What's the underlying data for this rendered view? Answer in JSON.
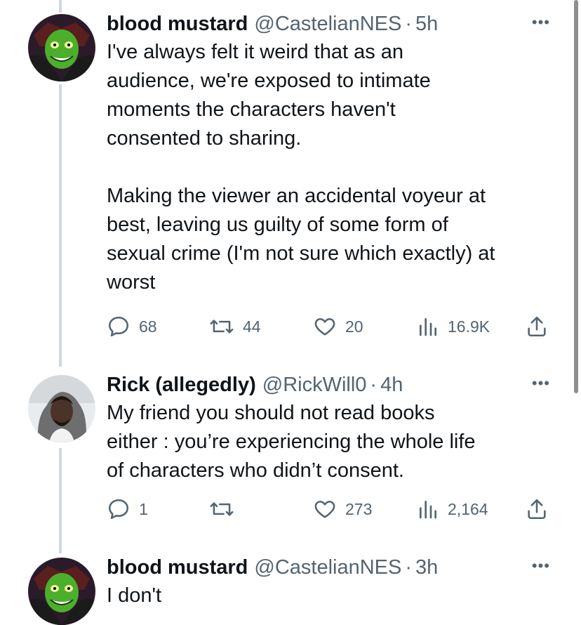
{
  "tweets": [
    {
      "name": "blood mustard",
      "handle": "@CastelianNES",
      "time": "5h",
      "text": "I've always felt it weird that as an\naudience, we're exposed to intimate\nmoments the characters haven't\nconsented to sharing.\n\nMaking the viewer an accidental voyeur at\nbest, leaving us guilty of some form of\nsexual crime (I'm not sure which exactly) at\nworst",
      "replies": "68",
      "retweets": "44",
      "likes": "20",
      "views": "16.9K"
    },
    {
      "name": "Rick (allegedly)",
      "handle": "@RickWill0",
      "time": "4h",
      "text": "My friend you should not read books\neither : you’re experiencing the whole life\nof characters who didn’t consent.",
      "replies": "1",
      "retweets": "",
      "likes": "273",
      "views": "2,164"
    },
    {
      "name": "blood mustard",
      "handle": "@CastelianNES",
      "time": "3h",
      "text": "I don't"
    }
  ],
  "ui": {
    "dot": "·",
    "more": "•••"
  },
  "colors": {
    "text": "#0f1419",
    "secondary": "#536471",
    "thread_line": "#cfd9de"
  },
  "icons": [
    "reply-icon",
    "retweet-icon",
    "like-icon",
    "views-icon",
    "share-icon",
    "more-icon"
  ]
}
